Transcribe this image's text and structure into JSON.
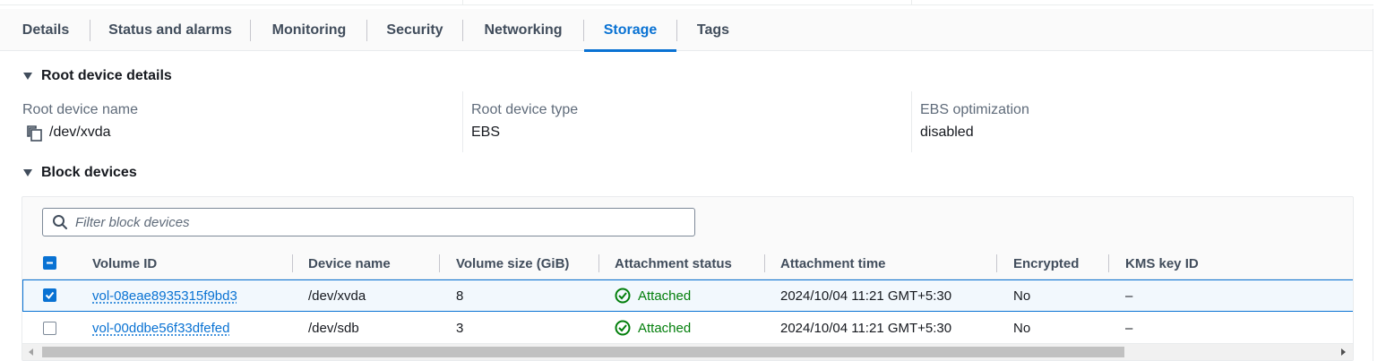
{
  "tabs": [
    {
      "label": "Details",
      "active": false
    },
    {
      "label": "Status and alarms",
      "active": false
    },
    {
      "label": "Monitoring",
      "active": false
    },
    {
      "label": "Security",
      "active": false
    },
    {
      "label": "Networking",
      "active": false
    },
    {
      "label": "Storage",
      "active": true
    },
    {
      "label": "Tags",
      "active": false
    }
  ],
  "root_device": {
    "section_title": "Root device details",
    "name_label": "Root device name",
    "name_value": "/dev/xvda",
    "type_label": "Root device type",
    "type_value": "EBS",
    "ebs_label": "EBS optimization",
    "ebs_value": "disabled"
  },
  "block_devices": {
    "section_title": "Block devices",
    "filter_placeholder": "Filter block devices",
    "columns": [
      "Volume ID",
      "Device name",
      "Volume size (GiB)",
      "Attachment status",
      "Attachment time",
      "Encrypted",
      "KMS key ID"
    ],
    "rows": [
      {
        "volume_id": "vol-08eae8935315f9bd3",
        "device": "/dev/xvda",
        "size": "8",
        "status": "Attached",
        "time": "2024/10/04 11:21 GMT+5:30",
        "encrypted": "No",
        "kms": "–",
        "selected": true
      },
      {
        "volume_id": "vol-00ddbe56f33dfefed",
        "device": "/dev/sdb",
        "size": "3",
        "status": "Attached",
        "time": "2024/10/04 11:21 GMT+5:30",
        "encrypted": "No",
        "kms": "–",
        "selected": false
      }
    ]
  },
  "colors": {
    "accent": "#0972d3",
    "success": "#037f0c",
    "text": "#16191f",
    "muted": "#5f6b7a"
  }
}
